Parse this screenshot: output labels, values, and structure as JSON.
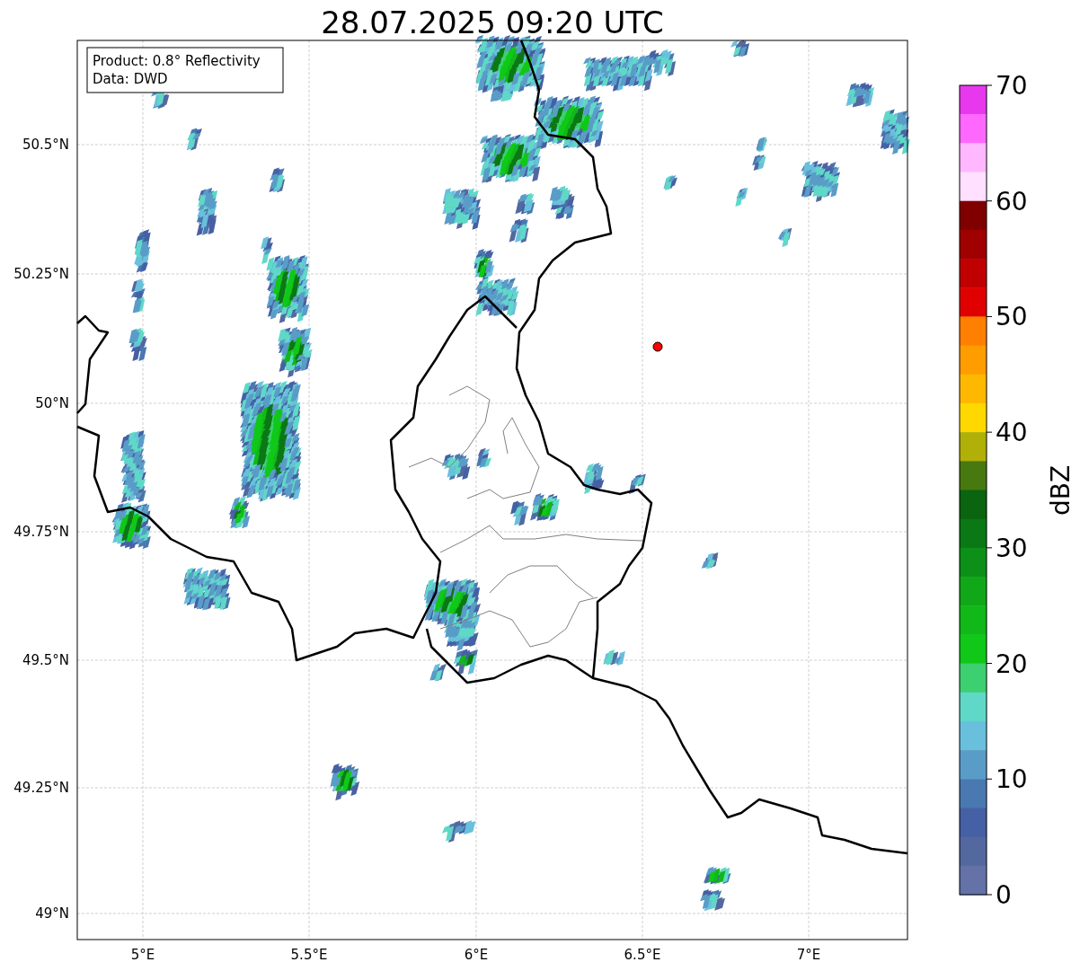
{
  "title": "28.07.2025 09:20 UTC",
  "info_box": {
    "lines": [
      "Product: 0.8° Reflectivity",
      "Data: DWD"
    ]
  },
  "map": {
    "x_ticks": [
      "5°E",
      "5.5°E",
      "6°E",
      "6.5°E",
      "7°E"
    ],
    "y_ticks": [
      "50.5°N",
      "50.25°N",
      "50°N",
      "49.75°N",
      "49.5°N",
      "49.25°N",
      "49°N"
    ]
  },
  "colorbar": {
    "label": "dBZ",
    "ticks": [
      "70",
      "60",
      "50",
      "40",
      "30",
      "20",
      "10",
      "0"
    ],
    "segments": [
      {
        "color": "#e838ee"
      },
      {
        "color": "#ff68ff"
      },
      {
        "color": "#ffb8ff"
      },
      {
        "color": "#ffe0ff"
      },
      {
        "color": "#800000"
      },
      {
        "color": "#a00000"
      },
      {
        "color": "#c00000"
      },
      {
        "color": "#e00000"
      },
      {
        "color": "#ff8000"
      },
      {
        "color": "#ff9c00"
      },
      {
        "color": "#ffb800"
      },
      {
        "color": "#ffd800"
      },
      {
        "color": "#b0b008"
      },
      {
        "color": "#487810"
      },
      {
        "color": "#0a6410"
      },
      {
        "color": "#0a7814"
      },
      {
        "color": "#0c9018"
      },
      {
        "color": "#10a818"
      },
      {
        "color": "#10b818"
      },
      {
        "color": "#10c818"
      },
      {
        "color": "#3cd070"
      },
      {
        "color": "#60d8c8"
      },
      {
        "color": "#68c0dc"
      },
      {
        "color": "#5a9cc8"
      },
      {
        "color": "#4a78b0"
      },
      {
        "color": "#4560a4"
      },
      {
        "color": "#5468a0"
      },
      {
        "color": "#6472a8"
      }
    ]
  }
}
